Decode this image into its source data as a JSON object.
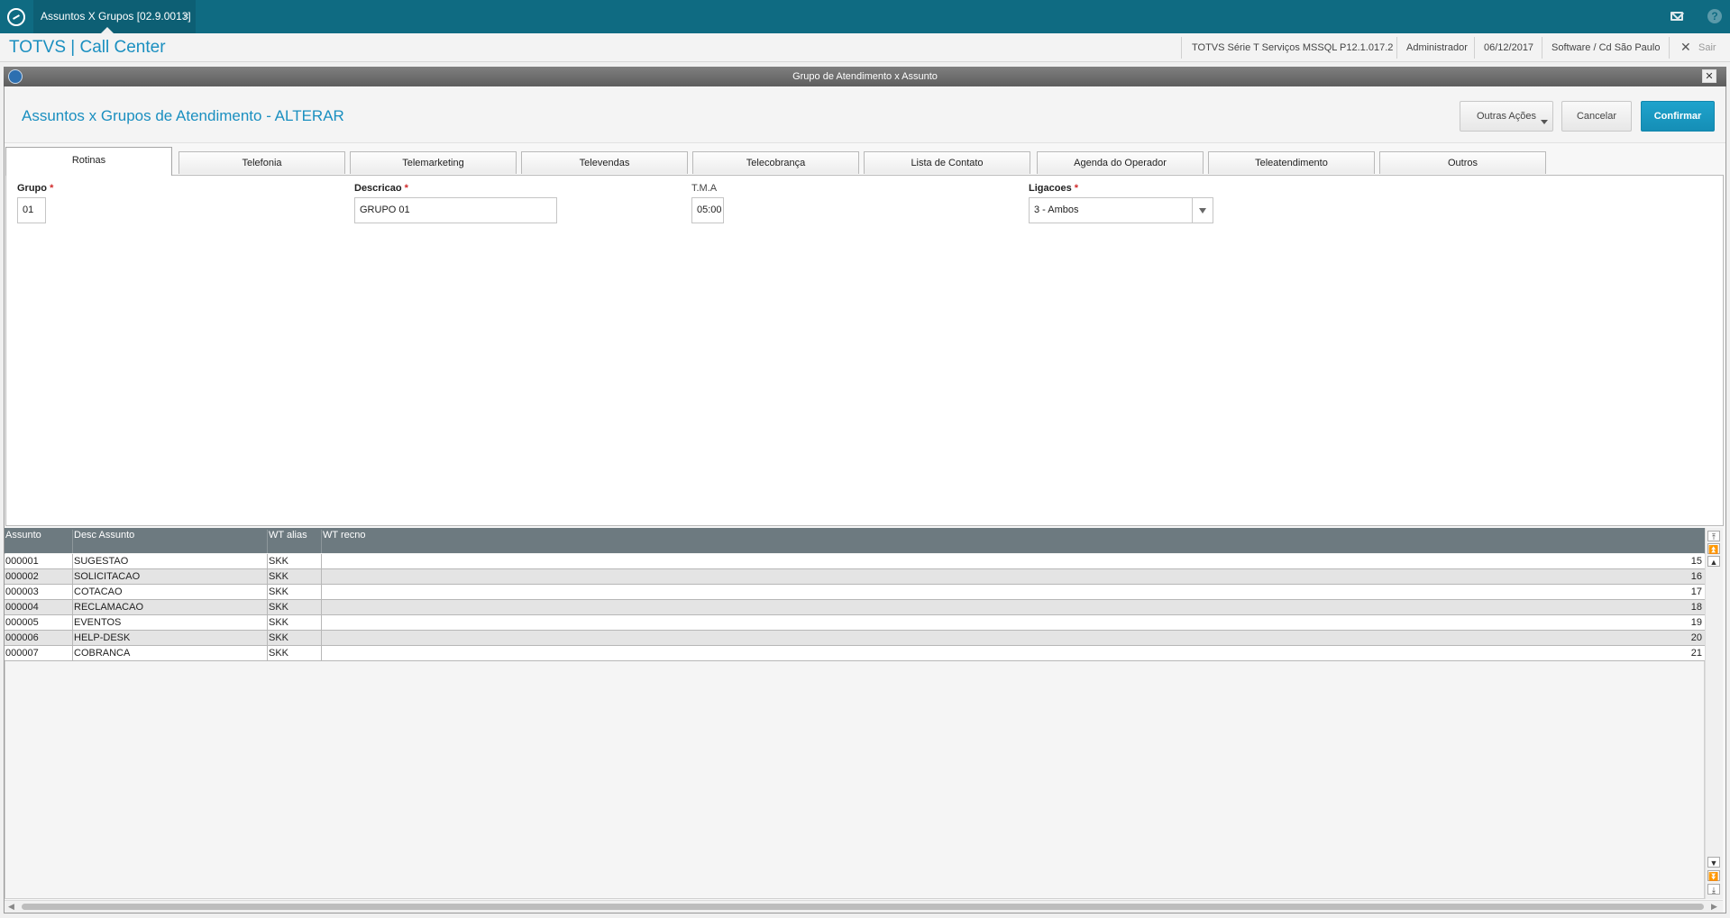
{
  "topbar": {
    "tab_label": "Assuntos X Grupos [02.9.0013]",
    "tab_close": "×",
    "help_glyph": "?",
    "icons": [
      "app-logo-icon",
      "mail-icon",
      "help-icon"
    ]
  },
  "header": {
    "app_title": "TOTVS | Call Center",
    "environment": "TOTVS Série T Serviços MSSQL P12.1.017.2",
    "user": "Administrador",
    "date": "06/12/2017",
    "company": "Software / Cd São Paulo",
    "exit_glyph": "✕",
    "exit_label": "Sair"
  },
  "dialog": {
    "title": "Grupo de Atendimento x Assunto",
    "close_glyph": "✕",
    "form_title": "Assuntos x Grupos de Atendimento - ALTERAR",
    "buttons": {
      "other_actions": "Outras Ações",
      "cancel": "Cancelar",
      "confirm": "Confirmar"
    },
    "accent_color": "#1a8fc0",
    "tabs": [
      "Rotinas",
      "Telefonia",
      "Telemarketing",
      "Televendas",
      "Telecobrança",
      "Lista de Contato",
      "Agenda do Operador",
      "Teleatendimento",
      "Outros"
    ],
    "active_tab": "Rotinas"
  },
  "form": {
    "grupo": {
      "label": "Grupo",
      "required": "*",
      "value": "01"
    },
    "descricao": {
      "label": "Descricao",
      "required": "*",
      "value": "GRUPO 01"
    },
    "tma": {
      "label": "T.M.A",
      "value": "05:00"
    },
    "ligacoes": {
      "label": "Ligacoes",
      "required": "*",
      "value": "3 - Ambos"
    }
  },
  "grid": {
    "columns": [
      "Assunto",
      "Desc Assunto",
      "WT alias",
      "WT recno"
    ],
    "rows": [
      [
        "000001",
        "SUGESTAO",
        "SKK",
        "15"
      ],
      [
        "000002",
        "SOLICITACAO",
        "SKK",
        "16"
      ],
      [
        "000003",
        "COTACAO",
        "SKK",
        "17"
      ],
      [
        "000004",
        "RECLAMACAO",
        "SKK",
        "18"
      ],
      [
        "000005",
        "EVENTOS",
        "SKK",
        "19"
      ],
      [
        "000006",
        "HELP-DESK",
        "SKK",
        "20"
      ],
      [
        "000007",
        "COBRANCA",
        "SKK",
        "21"
      ]
    ]
  }
}
